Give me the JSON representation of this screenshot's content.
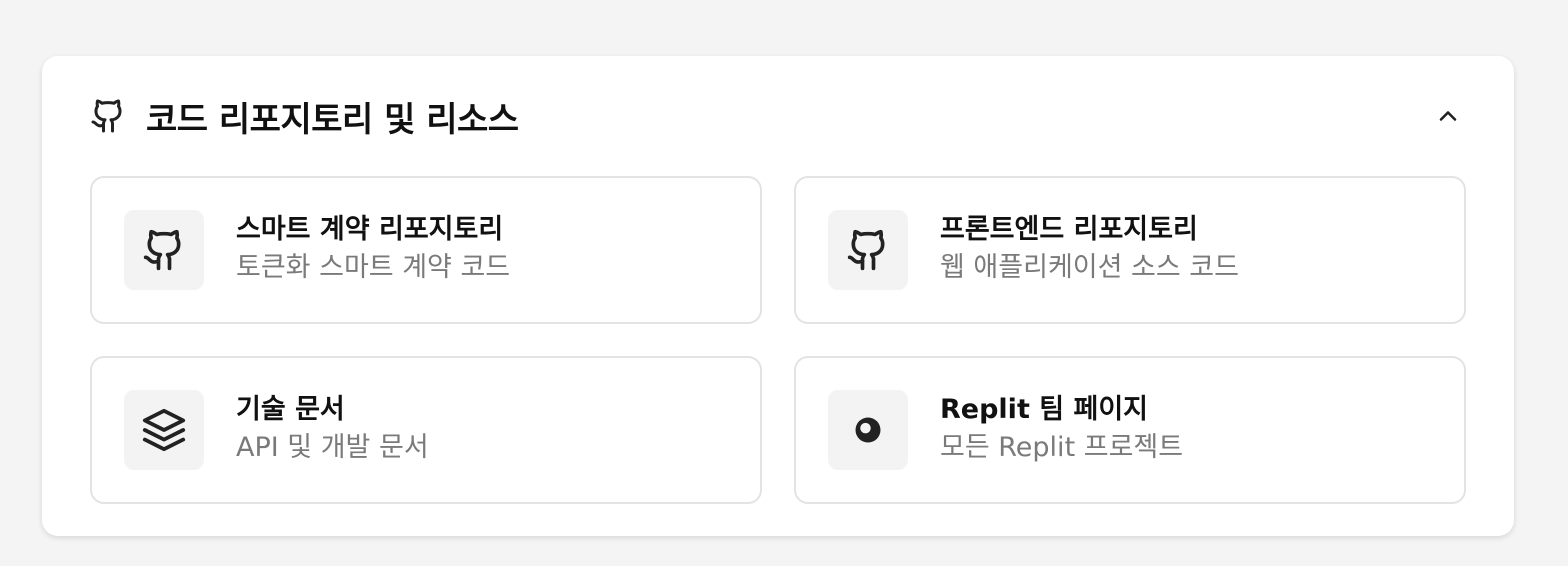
{
  "section": {
    "title": "코드 리포지토리 및 리소스",
    "icon": "github-icon",
    "collapse_icon": "chevron-up-icon"
  },
  "cards": [
    {
      "icon": "github-icon",
      "title": "스마트 계약 리포지토리",
      "subtitle": "토큰화 스마트 계약 코드"
    },
    {
      "icon": "github-icon",
      "title": "프론트엔드 리포지토리",
      "subtitle": "웹 애플리케이션 소스 코드"
    },
    {
      "icon": "layers-icon",
      "title": "기술 문서",
      "subtitle": "API 및 개발 문서"
    },
    {
      "icon": "replit-icon",
      "title": "Replit 팀 페이지",
      "subtitle": "모든 Replit 프로젝트"
    }
  ],
  "colors": {
    "background": "#f4f4f4",
    "panel": "#ffffff",
    "card_border": "#e3e3e3",
    "icon_tile": "#f3f3f3",
    "subtitle": "#7a7a7a",
    "icon_stroke": "#222222"
  }
}
